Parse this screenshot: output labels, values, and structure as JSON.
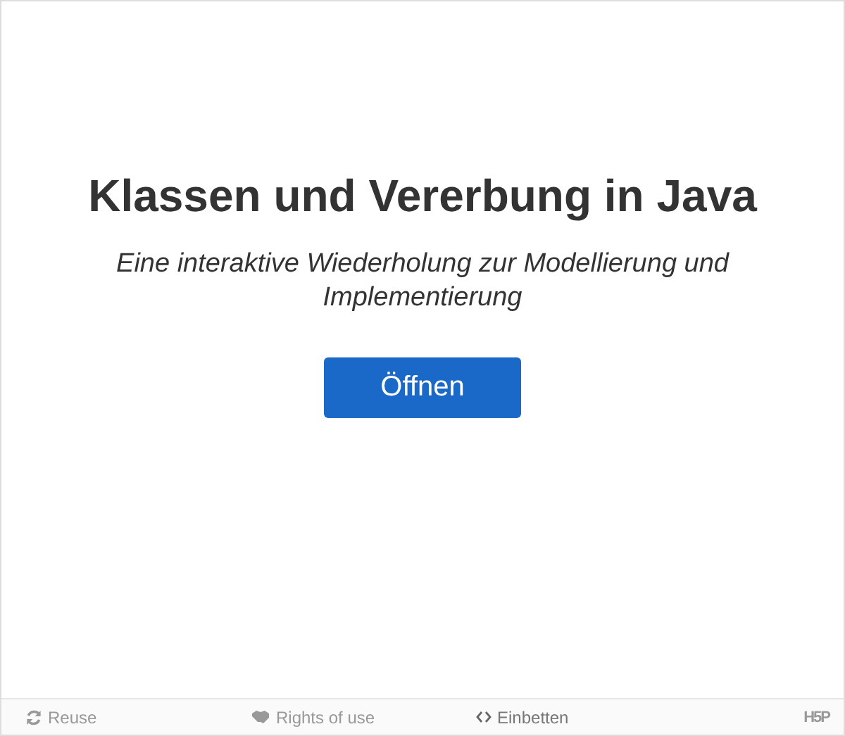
{
  "title": "Klassen und Vererbung in Java",
  "subtitle": "Eine interaktive Wiederholung zur Modellierung und Implementierung",
  "open_button": "Öffnen",
  "footer": {
    "actions": [
      {
        "kind": "reuse",
        "label": "Reuse"
      },
      {
        "kind": "rights",
        "label": "Rights of use"
      },
      {
        "kind": "embed",
        "label": "Einbetten"
      }
    ],
    "logo": "H5P"
  }
}
